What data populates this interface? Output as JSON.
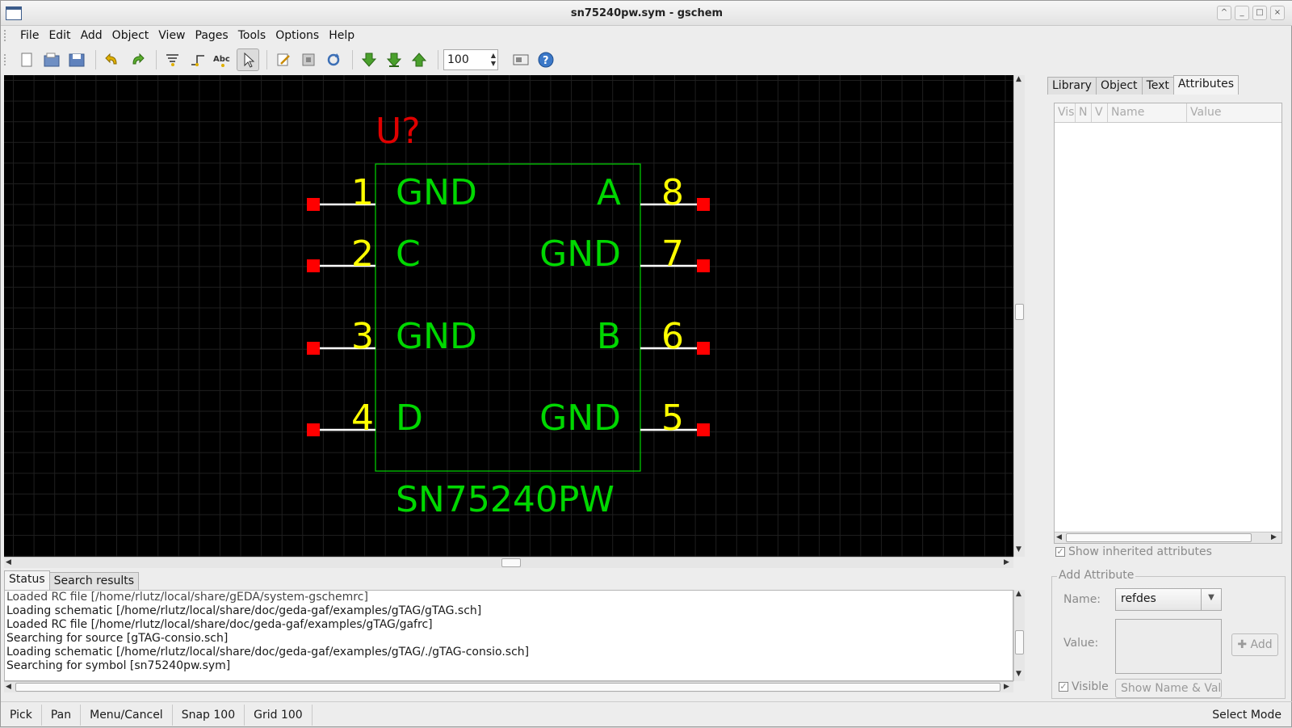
{
  "window": {
    "title": "sn75240pw.sym - gschem",
    "controls": [
      "^",
      "_",
      "□",
      "×"
    ]
  },
  "menu": [
    "File",
    "Edit",
    "Add",
    "Object",
    "View",
    "Pages",
    "Tools",
    "Options",
    "Help"
  ],
  "toolbar": {
    "zoom_value": "100",
    "icons": [
      "new-file-icon",
      "open-file-icon",
      "save-file-icon",
      "undo-icon",
      "redo-icon",
      "add-component-icon",
      "add-net-icon",
      "add-text-icon",
      "select-pointer-icon",
      "edit-icon",
      "hierarchy-icon",
      "rotate-refresh-icon",
      "down-schematic-icon",
      "down-symbol-icon",
      "up-hierarchy-icon",
      "zoom-box-icon",
      "help-icon"
    ]
  },
  "symbol": {
    "refdes": "U?",
    "device": "SN75240PW",
    "left_pins": [
      {
        "num": "1",
        "name": "GND"
      },
      {
        "num": "2",
        "name": "C"
      },
      {
        "num": "3",
        "name": "GND"
      },
      {
        "num": "4",
        "name": "D"
      }
    ],
    "right_pins": [
      {
        "num": "8",
        "name": "A"
      },
      {
        "num": "7",
        "name": "GND"
      },
      {
        "num": "6",
        "name": "B"
      },
      {
        "num": "5",
        "name": "GND"
      }
    ],
    "colors": {
      "body": "#00d700",
      "pin_number": "#ffff00",
      "refdes": "#e00000",
      "pin_end": "#ff0000",
      "pin_line": "#ffffff"
    }
  },
  "right_tabs": {
    "library": "Library",
    "object": "Object",
    "text": "Text",
    "attributes": "Attributes"
  },
  "attr_table": {
    "vis": "Vis",
    "n": "N",
    "v": "V",
    "name": "Name",
    "value": "Value"
  },
  "inherited_label": "Show inherited attributes",
  "add_attribute": {
    "legend": "Add Attribute",
    "name_label": "Name:",
    "name_value": "refdes",
    "value_label": "Value:",
    "add_button": "Add",
    "visible_label": "Visible",
    "show_button": "Show Name & Value"
  },
  "bottom_tabs": {
    "status": "Status",
    "search": "Search results"
  },
  "log": [
    "Loaded RC file [/home/rlutz/local/share/gEDA/system-gschemrc]",
    "Loading schematic [/home/rlutz/local/share/doc/geda-gaf/examples/gTAG/gTAG.sch]",
    "Loaded RC file [/home/rlutz/local/share/doc/geda-gaf/examples/gTAG/gafrc]",
    "Searching for source [gTAG-consio.sch]",
    "Loading schematic [/home/rlutz/local/share/doc/geda-gaf/examples/gTAG/./gTAG-consio.sch]",
    "Searching for symbol [sn75240pw.sym]"
  ],
  "statusbar": {
    "pick": "Pick",
    "pan": "Pan",
    "menu": "Menu/Cancel",
    "snap": "Snap 100",
    "grid": "Grid 100",
    "mode": "Select Mode"
  }
}
